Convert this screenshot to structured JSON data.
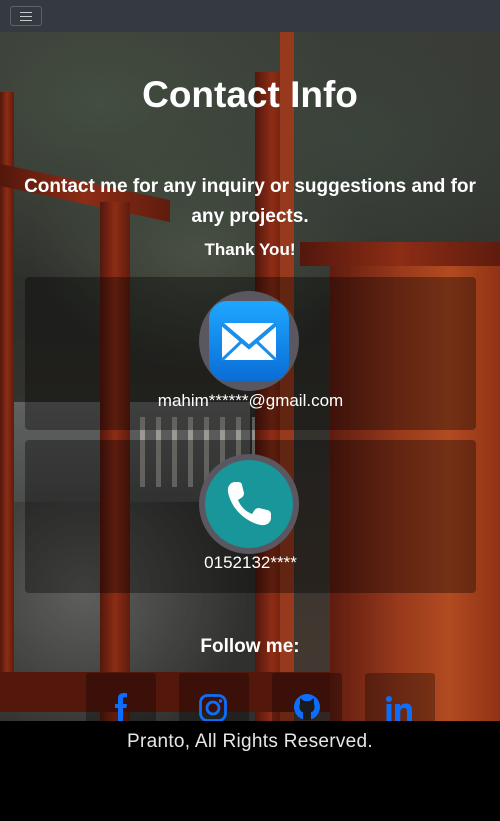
{
  "navbar": {
    "toggle_icon": "hamburger-icon"
  },
  "header": {
    "title": "Contact Info",
    "intro": "Contact me for any inquiry or suggestions and for any projects.",
    "thanks": "Thank You!"
  },
  "contacts": {
    "email": {
      "icon": "mail-icon",
      "text": "mahim******@gmail.com"
    },
    "phone": {
      "icon": "phone-icon",
      "text": "0152132****"
    }
  },
  "follow": {
    "label": "Follow me:",
    "links": [
      {
        "name": "facebook",
        "icon": "facebook-icon"
      },
      {
        "name": "instagram",
        "icon": "instagram-icon"
      },
      {
        "name": "github",
        "icon": "github-icon"
      },
      {
        "name": "linkedin",
        "icon": "linkedin-icon"
      }
    ],
    "link_color": "#0d6efd"
  },
  "footer": {
    "text": "Pranto, All Rights Reserved."
  },
  "colors": {
    "navbar": "#343a40",
    "footer": "#000000",
    "email_tile": "#1ea7ff",
    "phone_disc": "#18969a"
  }
}
